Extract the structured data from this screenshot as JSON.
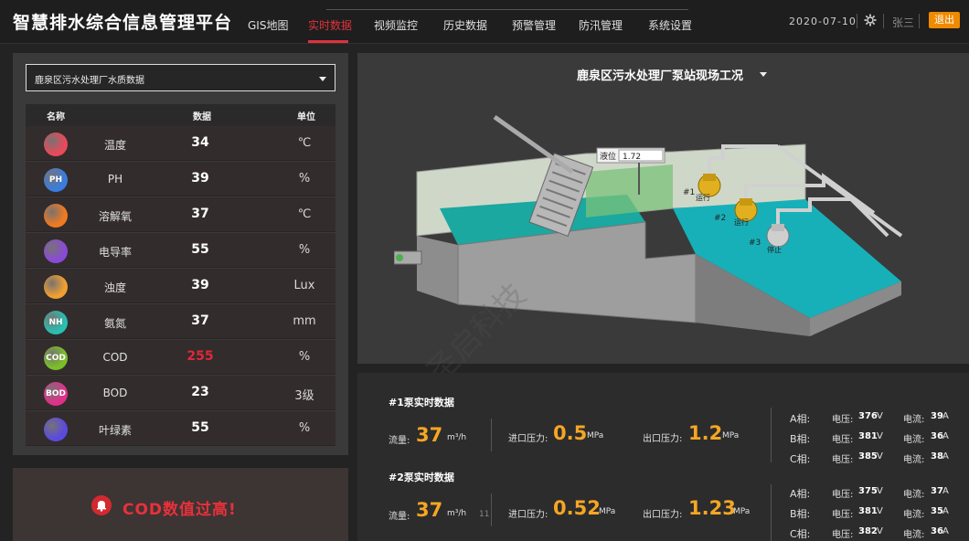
{
  "app": {
    "title": "智慧排水综合信息管理平台"
  },
  "nav": {
    "items": [
      "GIS地图",
      "实时数据",
      "视频监控",
      "历史数据",
      "预警管理",
      "防汛管理",
      "系统设置"
    ],
    "active_index": 1
  },
  "header": {
    "date": "2020-07-10",
    "user": "张三",
    "logout_label": "退出"
  },
  "colors": {
    "accent": "#e0323a",
    "highlight": "#f5a623",
    "logout": "#f08a00",
    "alarm": "#e0283a"
  },
  "quality": {
    "selected_station": "鹿泉区污水处理厂水质数据",
    "headers": {
      "name": "名称",
      "value": "数据",
      "unit": "单位"
    },
    "rows": [
      {
        "name": "温度",
        "value": "34",
        "unit": "℃",
        "icon": "thermometer-icon",
        "icon_text": "",
        "color": "#e84a5a"
      },
      {
        "name": "PH",
        "value": "39",
        "unit": "%",
        "icon": "ph-icon",
        "icon_text": "PH",
        "color": "#3a7de0"
      },
      {
        "name": "溶解氧",
        "value": "37",
        "unit": "℃",
        "icon": "oxygen-icon",
        "icon_text": "",
        "color": "#f07a20"
      },
      {
        "name": "电导率",
        "value": "55",
        "unit": "%",
        "icon": "lightning-icon",
        "icon_text": "",
        "color": "#8a4ad8"
      },
      {
        "name": "浊度",
        "value": "39",
        "unit": "Lux",
        "icon": "turbidity-icon",
        "icon_text": "",
        "color": "#f0a030"
      },
      {
        "name": "氨氮",
        "value": "37",
        "unit": "mm",
        "icon": "nh3-icon",
        "icon_text": "NH",
        "color": "#28c0b0"
      },
      {
        "name": "COD",
        "value": "255",
        "unit": "%",
        "icon": "cod-icon",
        "icon_text": "COD",
        "color": "#7ac028",
        "alarm": true
      },
      {
        "name": "BOD",
        "value": "23",
        "unit": "3级",
        "icon": "bod-icon",
        "icon_text": "BOD",
        "color": "#e0308a"
      },
      {
        "name": "叶绿素",
        "value": "55",
        "unit": "%",
        "icon": "chlorophyll-icon",
        "icon_text": "",
        "color": "#5a4ae0"
      }
    ]
  },
  "alert": {
    "text": "COD数值过高!"
  },
  "scene": {
    "title": "鹿泉区污水处理厂泵站现场工况",
    "level_label": "液位",
    "level_value": "1.72",
    "pumps": [
      "#1",
      "#2",
      "#3"
    ],
    "pump_status": [
      "运行",
      "运行",
      "停止"
    ],
    "watermark": "圣启科技"
  },
  "pumps": [
    {
      "title": "#1泵实时数据",
      "flow_label": "流量:",
      "flow": "37",
      "flow_unit": "m³/h",
      "in_label": "进口压力:",
      "in": "0.5",
      "in_unit": "MPa",
      "out_label": "出口压力:",
      "out": "1.2",
      "out_unit": "MPa",
      "phases": [
        {
          "name": "A相:",
          "v_label": "电压:",
          "v": "376",
          "v_unit": "V",
          "a_label": "电流:",
          "a": "39",
          "a_unit": "A"
        },
        {
          "name": "B相:",
          "v_label": "电压:",
          "v": "381",
          "v_unit": "V",
          "a_label": "电流:",
          "a": "36",
          "a_unit": "A"
        },
        {
          "name": "C相:",
          "v_label": "电压:",
          "v": "385",
          "v_unit": "V",
          "a_label": "电流:",
          "a": "38",
          "a_unit": "A"
        }
      ]
    },
    {
      "title": "#2泵实时数据",
      "flow_label": "流量:",
      "flow": "37",
      "flow_unit": "m³/h",
      "in_label": "进口压力:",
      "in": "0.52",
      "in_unit": "MPa",
      "out_label": "出口压力:",
      "out": "1.23",
      "out_unit": "MPa",
      "stray": "11",
      "phases": [
        {
          "name": "A相:",
          "v_label": "电压:",
          "v": "375",
          "v_unit": "V",
          "a_label": "电流:",
          "a": "37",
          "a_unit": "A"
        },
        {
          "name": "B相:",
          "v_label": "电压:",
          "v": "381",
          "v_unit": "V",
          "a_label": "电流:",
          "a": "35",
          "a_unit": "A"
        },
        {
          "name": "C相:",
          "v_label": "电压:",
          "v": "382",
          "v_unit": "V",
          "a_label": "电流:",
          "a": "36",
          "a_unit": "A"
        }
      ]
    }
  ]
}
